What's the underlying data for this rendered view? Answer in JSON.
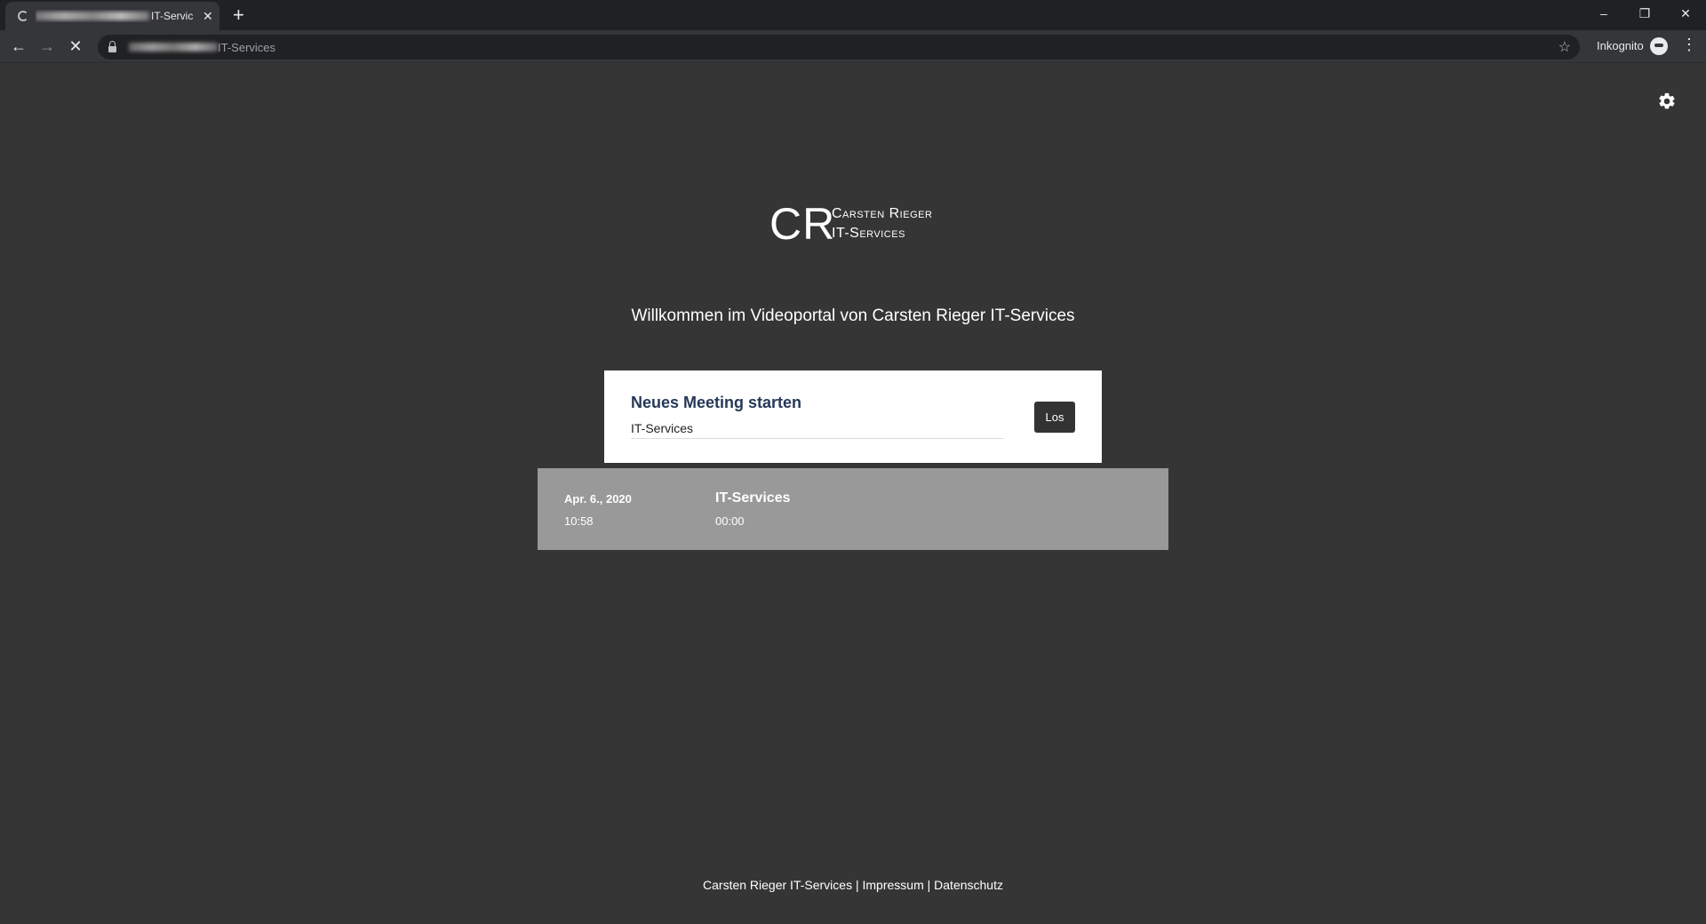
{
  "browser": {
    "tab_title_suffix": "IT-Servic",
    "new_tab_symbol": "+",
    "url_suffix": "IT-Services",
    "incognito_label": "Inkognito",
    "window_controls": {
      "minimize": "–",
      "maximize": "❐",
      "close": "✕"
    }
  },
  "header": {
    "settings_icon": "gear-icon"
  },
  "logo": {
    "initials": "CR",
    "line1": "Carsten Rieger",
    "line2": "IT-Services"
  },
  "welcome_text": "Willkommen im Videoportal von Carsten Rieger IT-Services",
  "meeting_card": {
    "title": "Neues Meeting starten",
    "input_value": "IT-Services",
    "button_label": "Los"
  },
  "recent_meetings": [
    {
      "date": "Apr. 6., 2020",
      "time": "10:58",
      "name": "IT-Services",
      "duration": "00:00"
    }
  ],
  "footer": {
    "company": "Carsten Rieger IT-Services",
    "separator": "|",
    "impressum": "Impressum",
    "datenschutz": "Datenschutz"
  }
}
